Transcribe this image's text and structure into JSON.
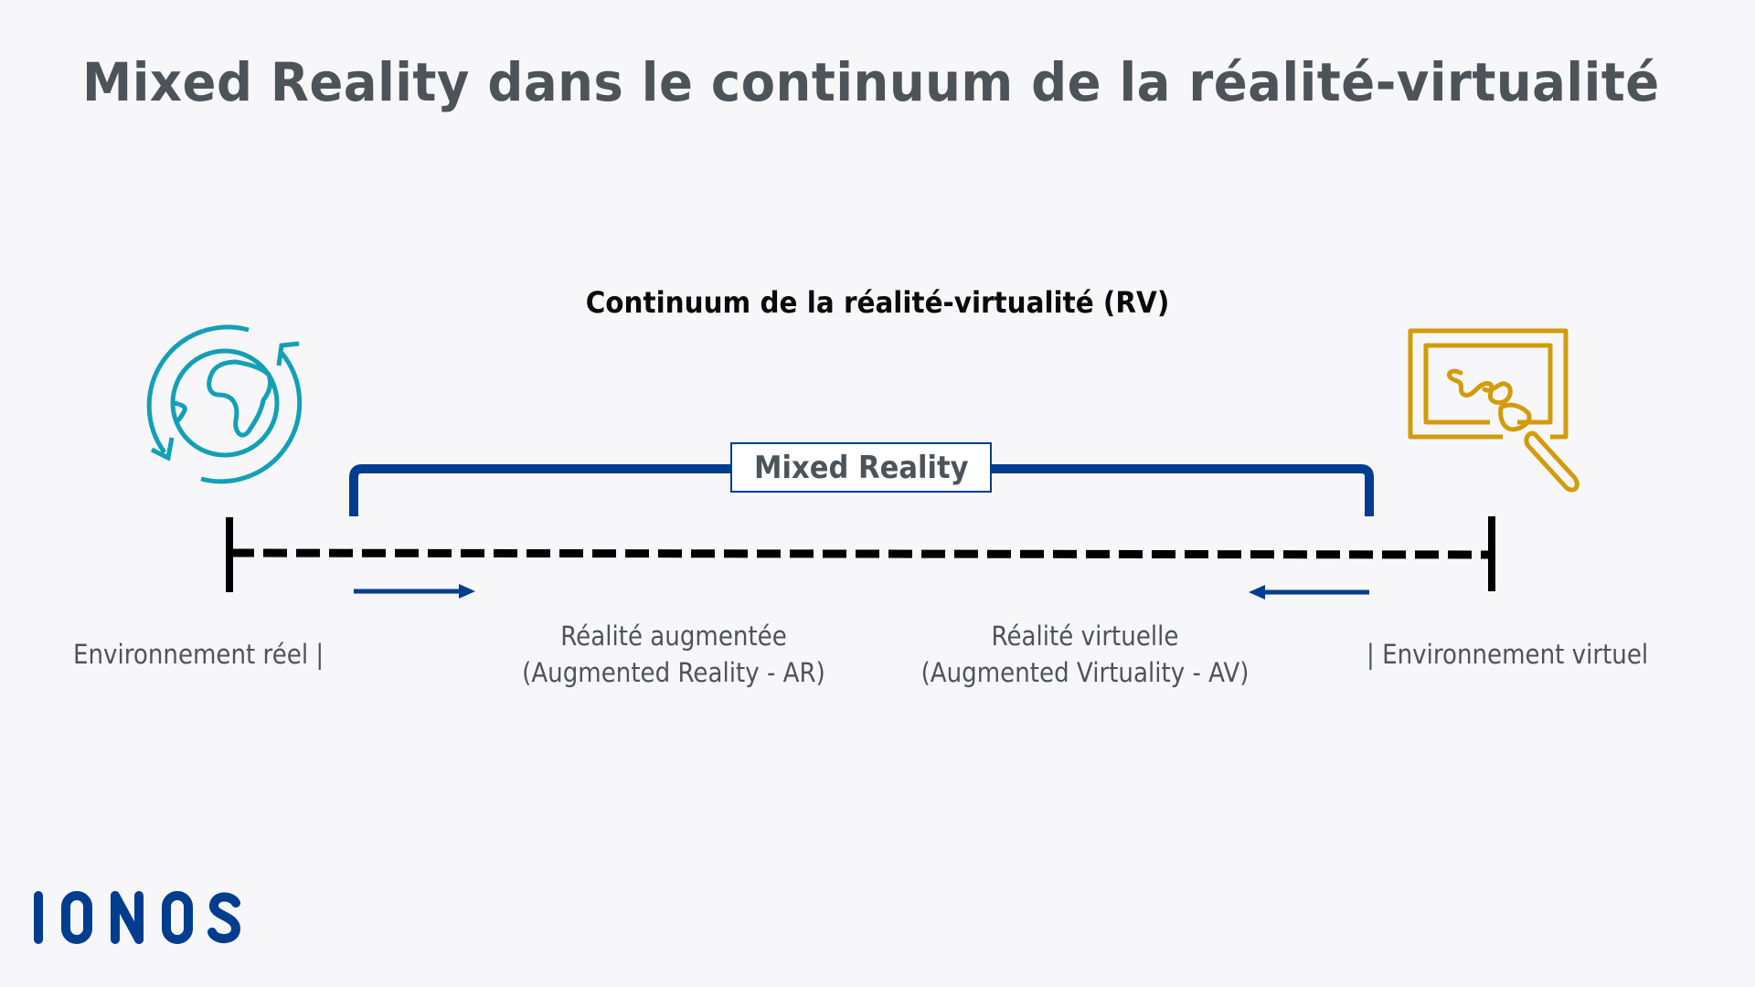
{
  "title": "Mixed Reality dans le continuum de la réalité-virtualité",
  "diagram": {
    "subtitle": "Continuum de la réalité-virtualité (RV)",
    "bracket_label": "Mixed Reality",
    "left_end": {
      "label": "Environnement réel |",
      "icon": "globe-rotate-icon"
    },
    "right_end": {
      "label": "| Environnement virtuel",
      "icon": "canvas-paintbrush-icon"
    },
    "middle_left": {
      "line1": "Réalité augmentée",
      "line2": "(Augmented Reality - AR)",
      "arrow_direction": "right"
    },
    "middle_right": {
      "line1": "Réalité virtuelle",
      "line2": "(Augmented Virtuality - AV)",
      "arrow_direction": "left"
    }
  },
  "colors": {
    "background": "#f7f7f9",
    "title_text": "#4d5459",
    "brand_blue": "#003d8f",
    "globe_teal": "#12a0b8",
    "canvas_gold": "#d39b0b",
    "axis_black": "#000000"
  },
  "logo": {
    "text": "IONOS"
  }
}
